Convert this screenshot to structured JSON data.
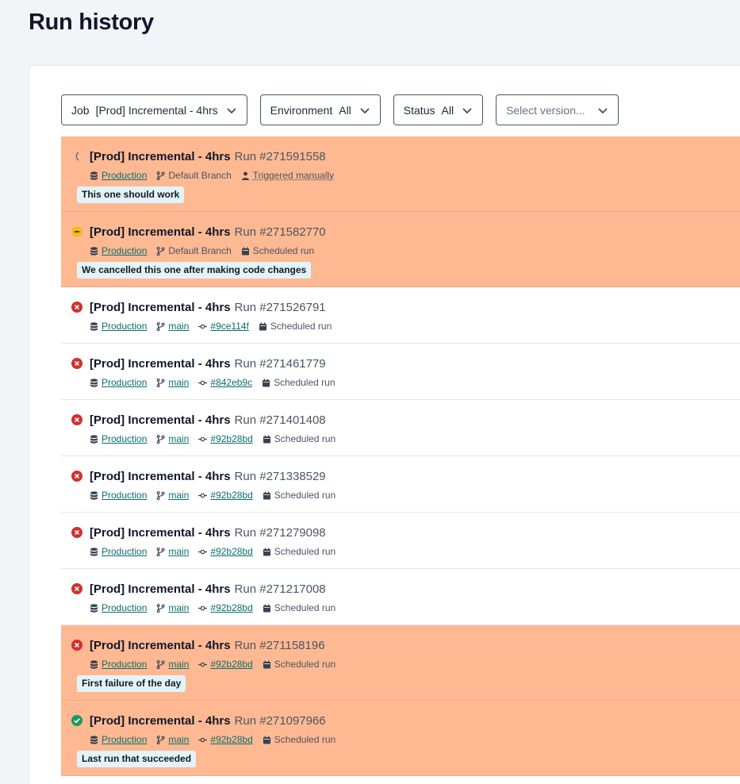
{
  "page": {
    "title": "Run history"
  },
  "filters": {
    "job": {
      "label": "Job",
      "value": "[Prod] Incremental - 4hrs"
    },
    "environment": {
      "label": "Environment",
      "value": "All"
    },
    "status": {
      "label": "Status",
      "value": "All"
    },
    "version": {
      "placeholder": "Select version..."
    }
  },
  "colors": {
    "highlight": "#feb992",
    "link": "#0b6e6e",
    "error": "#d32f2f",
    "success": "#169b62",
    "cancelled": "#f5b915",
    "note_bg": "#e3f4f8"
  },
  "runs": [
    {
      "status": "running",
      "job": "[Prod] Incremental - 4hrs",
      "run": "Run #271591558",
      "environment": "Production",
      "branch": "Default Branch",
      "branch_link": false,
      "commit": "",
      "trigger": "Triggered manually",
      "trigger_icon": "person-icon",
      "note": "This one should work",
      "highlight": true
    },
    {
      "status": "cancelled",
      "job": "[Prod] Incremental - 4hrs",
      "run": "Run #271582770",
      "environment": "Production",
      "branch": "Default Branch",
      "branch_link": false,
      "commit": "",
      "trigger": "Scheduled run",
      "trigger_icon": "calendar-icon",
      "note": "We cancelled this one after making code changes",
      "highlight": true
    },
    {
      "status": "error",
      "job": "[Prod] Incremental - 4hrs",
      "run": "Run #271526791",
      "environment": "Production",
      "branch": "main",
      "branch_link": true,
      "commit": "#9ce114f",
      "trigger": "Scheduled run",
      "trigger_icon": "calendar-icon",
      "note": "",
      "highlight": false
    },
    {
      "status": "error",
      "job": "[Prod] Incremental - 4hrs",
      "run": "Run #271461779",
      "environment": "Production",
      "branch": "main",
      "branch_link": true,
      "commit": "#842eb9c",
      "trigger": "Scheduled run",
      "trigger_icon": "calendar-icon",
      "note": "",
      "highlight": false
    },
    {
      "status": "error",
      "job": "[Prod] Incremental - 4hrs",
      "run": "Run #271401408",
      "environment": "Production",
      "branch": "main",
      "branch_link": true,
      "commit": "#92b28bd",
      "trigger": "Scheduled run",
      "trigger_icon": "calendar-icon",
      "note": "",
      "highlight": false
    },
    {
      "status": "error",
      "job": "[Prod] Incremental - 4hrs",
      "run": "Run #271338529",
      "environment": "Production",
      "branch": "main",
      "branch_link": true,
      "commit": "#92b28bd",
      "trigger": "Scheduled run",
      "trigger_icon": "calendar-icon",
      "note": "",
      "highlight": false
    },
    {
      "status": "error",
      "job": "[Prod] Incremental - 4hrs",
      "run": "Run #271279098",
      "environment": "Production",
      "branch": "main",
      "branch_link": true,
      "commit": "#92b28bd",
      "trigger": "Scheduled run",
      "trigger_icon": "calendar-icon",
      "note": "",
      "highlight": false
    },
    {
      "status": "error",
      "job": "[Prod] Incremental - 4hrs",
      "run": "Run #271217008",
      "environment": "Production",
      "branch": "main",
      "branch_link": true,
      "commit": "#92b28bd",
      "trigger": "Scheduled run",
      "trigger_icon": "calendar-icon",
      "note": "",
      "highlight": false
    },
    {
      "status": "error",
      "job": "[Prod] Incremental - 4hrs",
      "run": "Run #271158196",
      "environment": "Production",
      "branch": "main",
      "branch_link": true,
      "commit": "#92b28bd",
      "trigger": "Scheduled run",
      "trigger_icon": "calendar-icon",
      "note": "First failure of the day",
      "highlight": true
    },
    {
      "status": "success",
      "job": "[Prod] Incremental - 4hrs",
      "run": "Run #271097966",
      "environment": "Production",
      "branch": "main",
      "branch_link": true,
      "commit": "#92b28bd",
      "trigger": "Scheduled run",
      "trigger_icon": "calendar-icon",
      "note": "Last run that succeeded",
      "highlight": true
    }
  ]
}
